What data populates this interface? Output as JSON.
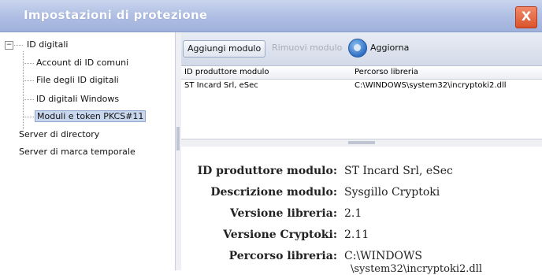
{
  "window": {
    "title": "Impostazioni di protezione",
    "close_glyph": "X"
  },
  "tree": {
    "expander_glyph": "−",
    "root": "ID digitali",
    "children": [
      "Account di ID comuni",
      "File degli ID digitali",
      "ID digitali Windows",
      "Moduli e token PKCS#11"
    ],
    "others": [
      "Server di directory",
      "Server di marca temporale"
    ],
    "selected": "Moduli e token PKCS#11"
  },
  "toolbar": {
    "add_label": "Aggiungi modulo",
    "remove_label": "Rimuovi modulo",
    "refresh_label": "Aggiorna",
    "refresh_icon": "refresh-icon"
  },
  "grid": {
    "columns": [
      "ID produttore modulo",
      "Percorso libreria"
    ],
    "rows": [
      [
        "ST Incard Srl, eSec",
        "C:\\WINDOWS\\system32\\incryptoki2.dll"
      ]
    ]
  },
  "details": {
    "fields": [
      {
        "label": "ID produttore modulo:",
        "value": "ST Incard Srl, eSec"
      },
      {
        "label": "Descrizione modulo:",
        "value": "Sysgillo Cryptoki"
      },
      {
        "label": "Versione libreria:",
        "value": "2.1"
      },
      {
        "label": "Versione Cryptoki:",
        "value": "2.11"
      },
      {
        "label": "Percorso libreria:",
        "value": "C:\\WINDOWS",
        "value2": "\\system32\\incryptoki2.dll"
      }
    ]
  },
  "colors": {
    "titlebar": "#aebde2",
    "selection": "#c8d7ee",
    "close": "#d9532c"
  }
}
